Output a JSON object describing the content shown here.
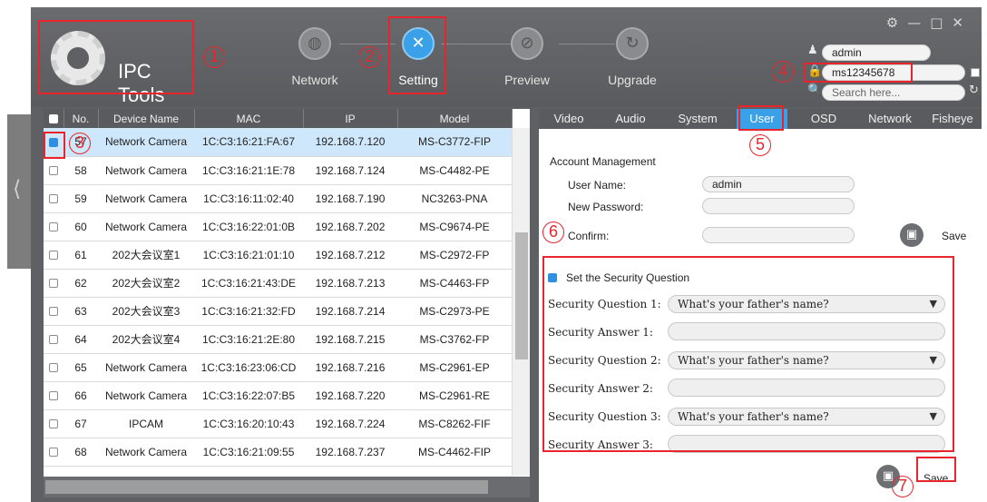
{
  "app": {
    "logo_text": "IPC Tools"
  },
  "steps": [
    {
      "label": "Network",
      "icon": "globe-icon",
      "active": false
    },
    {
      "label": "Setting",
      "icon": "tools-icon",
      "active": true
    },
    {
      "label": "Preview",
      "icon": "pencil-icon",
      "active": false
    },
    {
      "label": "Upgrade",
      "icon": "refresh-icon",
      "active": false
    }
  ],
  "window_controls": {
    "gear": "⚙",
    "minimize": "—",
    "maximize": "□",
    "close": "✕"
  },
  "login": {
    "username": "admin",
    "password": "ms12345678",
    "search_placeholder": "Search here..."
  },
  "table": {
    "columns": [
      "No.",
      "Device Name",
      "MAC",
      "IP",
      "Model"
    ],
    "rows": [
      {
        "checked": true,
        "no": "57",
        "name": "Network Camera",
        "mac": "1C:C3:16:21:FA:67",
        "ip": "192.168.7.120",
        "model": "MS-C3772-FIP"
      },
      {
        "checked": false,
        "no": "58",
        "name": "Network Camera",
        "mac": "1C:C3:16:21:1E:78",
        "ip": "192.168.7.124",
        "model": "MS-C4482-PE"
      },
      {
        "checked": false,
        "no": "59",
        "name": "Network Camera",
        "mac": "1C:C3:16:11:02:40",
        "ip": "192.168.7.190",
        "model": "NC3263-PNA"
      },
      {
        "checked": false,
        "no": "60",
        "name": "Network Camera",
        "mac": "1C:C3:16:22:01:0B",
        "ip": "192.168.7.202",
        "model": "MS-C9674-PE"
      },
      {
        "checked": false,
        "no": "61",
        "name": "202大会议室1",
        "mac": "1C:C3:16:21:01:10",
        "ip": "192.168.7.212",
        "model": "MS-C2972-FP"
      },
      {
        "checked": false,
        "no": "62",
        "name": "202大会议室2",
        "mac": "1C:C3:16:21:43:DE",
        "ip": "192.168.7.213",
        "model": "MS-C4463-FP"
      },
      {
        "checked": false,
        "no": "63",
        "name": "202大会议室3",
        "mac": "1C:C3:16:21:32:FD",
        "ip": "192.168.7.214",
        "model": "MS-C2973-PE"
      },
      {
        "checked": false,
        "no": "64",
        "name": "202大会议室4",
        "mac": "1C:C3:16:21:2E:80",
        "ip": "192.168.7.215",
        "model": "MS-C3762-FP"
      },
      {
        "checked": false,
        "no": "65",
        "name": "Network Camera",
        "mac": "1C:C3:16:23:06:CD",
        "ip": "192.168.7.216",
        "model": "MS-C2961-EP"
      },
      {
        "checked": false,
        "no": "66",
        "name": "Network Camera",
        "mac": "1C:C3:16:22:07:B5",
        "ip": "192.168.7.220",
        "model": "MS-C2961-RE"
      },
      {
        "checked": false,
        "no": "67",
        "name": "IPCAM",
        "mac": "1C:C3:16:20:10:43",
        "ip": "192.168.7.224",
        "model": "MS-C8262-FIF"
      },
      {
        "checked": false,
        "no": "68",
        "name": "Network Camera",
        "mac": "1C:C3:16:21:09:55",
        "ip": "192.168.7.237",
        "model": "MS-C4462-FIP"
      }
    ]
  },
  "tabs": [
    "Video",
    "Audio",
    "System",
    "User",
    "OSD",
    "Network",
    "Fisheye"
  ],
  "active_tab": "User",
  "account": {
    "title": "Account Management",
    "username_label": "User Name:",
    "username_value": "admin",
    "new_password_label": "New Password:",
    "confirm_label": "Confirm:",
    "save_label": "Save"
  },
  "security": {
    "title": "Set the Security Question",
    "q1_label": "Security Question 1:",
    "q1_value": "What's your father's name?",
    "a1_label": "Security Answer 1:",
    "q2_label": "Security Question 2:",
    "q2_value": "What's your father's name?",
    "a2_label": "Security Answer 2:",
    "q3_label": "Security Question 3:",
    "q3_value": "What's your father's name?",
    "a3_label": "Security Answer 3:",
    "save_label": "Save"
  },
  "annotations": [
    "1",
    "2",
    "3",
    "4",
    "5",
    "6",
    "7"
  ],
  "colors": {
    "accent": "#3aa0e8",
    "highlight": "#e8252d",
    "header": "#5f6063"
  }
}
